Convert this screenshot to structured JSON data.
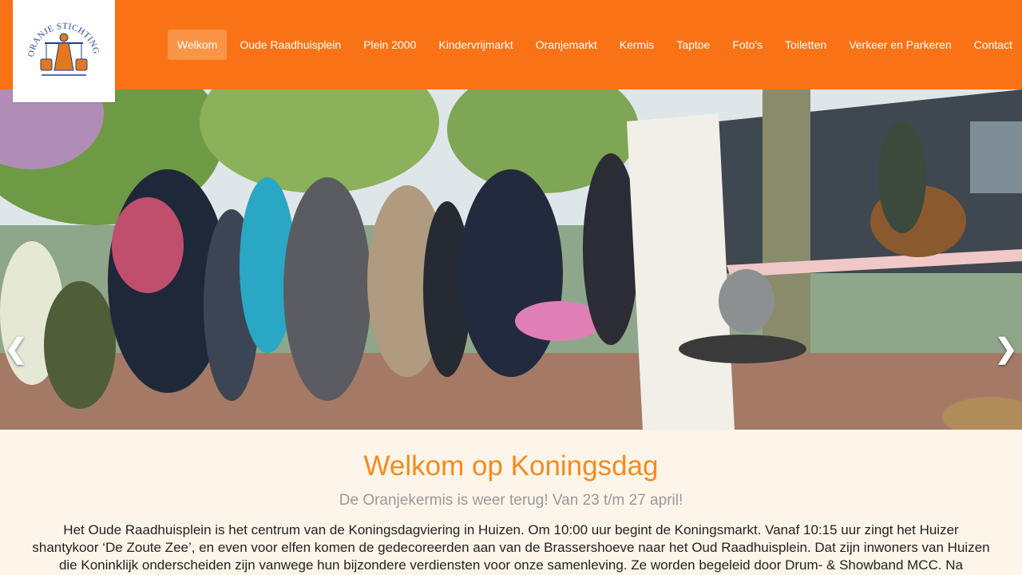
{
  "logo": {
    "text": "ORANJE STICHTING HUIZEN"
  },
  "nav": {
    "items": [
      {
        "label": "Welkom",
        "active": true
      },
      {
        "label": "Oude Raadhuisplein"
      },
      {
        "label": "Plein 2000"
      },
      {
        "label": "Kindervrijmarkt"
      },
      {
        "label": "Oranjemarkt"
      },
      {
        "label": "Kermis"
      },
      {
        "label": "Taptoe"
      },
      {
        "label": "Foto's"
      },
      {
        "label": "Toiletten"
      },
      {
        "label": "Verkeer en Parkeren"
      },
      {
        "label": "Contact"
      }
    ]
  },
  "carousel": {
    "prev_icon": "chevron-left-icon",
    "next_icon": "chevron-right-icon",
    "prev_glyph": "❮",
    "next_glyph": "❯"
  },
  "content": {
    "title": "Welkom op Koningsdag",
    "subtitle": "De Oranjekermis is weer terug! Van 23 t/m 27 april!",
    "intro": "Het Oude Raadhuisplein is het centrum van de Koningsdagviering in Huizen. Om 10:00 uur begint de Koningsmarkt. Vanaf 10:15 uur zingt het Huizer shantykoor ‘De Zoute Zee’, en even voor elfen komen de gedecoreerden aan van de Brassershoeve naar het Oud Raadhuisplein. Dat zijn inwoners van Huizen die Koninklijk onderscheiden zijn vanwege hun bijzondere verdiensten voor onze samenleving. Ze worden begeleid door Drum- & Showband MCC. Na verwelkoming door de Oranje Stichting Huizen, wordt"
  },
  "colors": {
    "brand": "#f97316",
    "active_nav": "#fa9447",
    "title": "#f58a1f",
    "background": "#fdf5ea"
  }
}
